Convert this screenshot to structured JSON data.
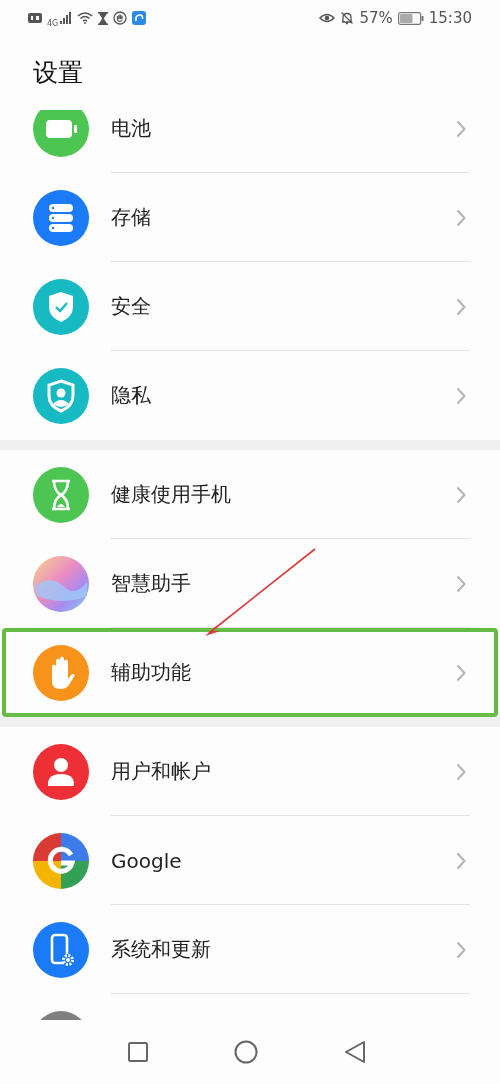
{
  "status_bar": {
    "network": "4G",
    "battery_percent": "57%",
    "time": "15:30"
  },
  "title": "设置",
  "groups": [
    {
      "items": [
        {
          "label": "电池",
          "kind": "battery",
          "color": "#4cc552",
          "highlighted": false
        },
        {
          "label": "存储",
          "kind": "storage",
          "color": "#1a7af8",
          "highlighted": false
        },
        {
          "label": "安全",
          "kind": "security",
          "color": "#17b9c2",
          "highlighted": false
        },
        {
          "label": "隐私",
          "kind": "privacy",
          "color": "#17b9c2",
          "highlighted": false
        }
      ]
    },
    {
      "items": [
        {
          "label": "健康使用手机",
          "kind": "hourglass",
          "color": "#4cc552",
          "highlighted": false
        },
        {
          "label": "智慧助手",
          "kind": "assistant",
          "highlighted": false
        },
        {
          "label": "辅助功能",
          "kind": "hand",
          "color": "#f7921a",
          "highlighted": true
        }
      ]
    },
    {
      "items": [
        {
          "label": "用户和帐户",
          "kind": "user",
          "color": "#ee2f35",
          "highlighted": false
        },
        {
          "label": "Google",
          "kind": "google",
          "highlighted": false
        },
        {
          "label": "系统和更新",
          "kind": "system",
          "color": "#1a7af8",
          "highlighted": false
        },
        {
          "kind": "generic",
          "color": "#808080",
          "highlighted": false
        }
      ]
    }
  ]
}
